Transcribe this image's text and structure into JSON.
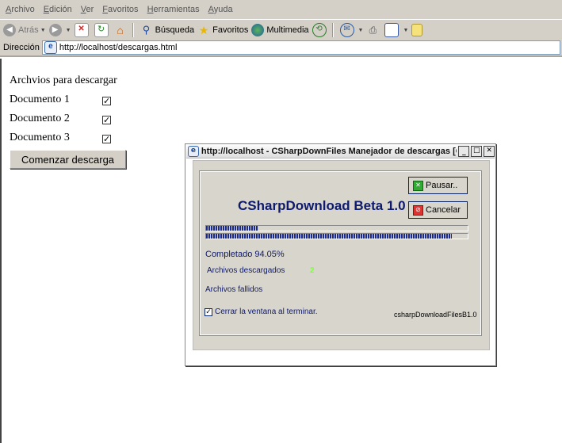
{
  "menu": [
    "Archivo",
    "Edición",
    "Ver",
    "Favoritos",
    "Herramientas",
    "Ayuda"
  ],
  "toolbar": {
    "back_label": "Atrás",
    "search_label": "Búsqueda",
    "favorites_label": "Favoritos",
    "media_label": "Multimedia"
  },
  "address": {
    "label": "Dirección",
    "url": "http://localhost/descargas.html"
  },
  "page": {
    "title": "Archvios para descargar",
    "documents": [
      {
        "label": "Documento 1",
        "checked": true
      },
      {
        "label": "Documento 2",
        "checked": true
      },
      {
        "label": "Documento 3",
        "checked": true
      }
    ],
    "start_button": "Comenzar descarga"
  },
  "popup": {
    "window_title": "http://localhost - CSharpDownFiles Manejador de descargas [Colaboraci...",
    "app_title": "CSharpDownload Beta 1.0",
    "pause_button": "Pausar..",
    "cancel_button": "Cancelar",
    "file_progress": 0.2,
    "total_progress": 0.94,
    "completed_text": "Completado 94.05%",
    "downloaded_label": "Archivos descargados",
    "downloaded_count": "2",
    "failed_label": "Archivos fallidos",
    "close_on_finish_label": "Cerrar la ventana al terminar.",
    "close_on_finish_checked": true,
    "version_text": "csharpDownloadFilesB1.0",
    "colors": {
      "title_blue": "#0d1a6d",
      "count_green": "#7fff3f"
    }
  }
}
